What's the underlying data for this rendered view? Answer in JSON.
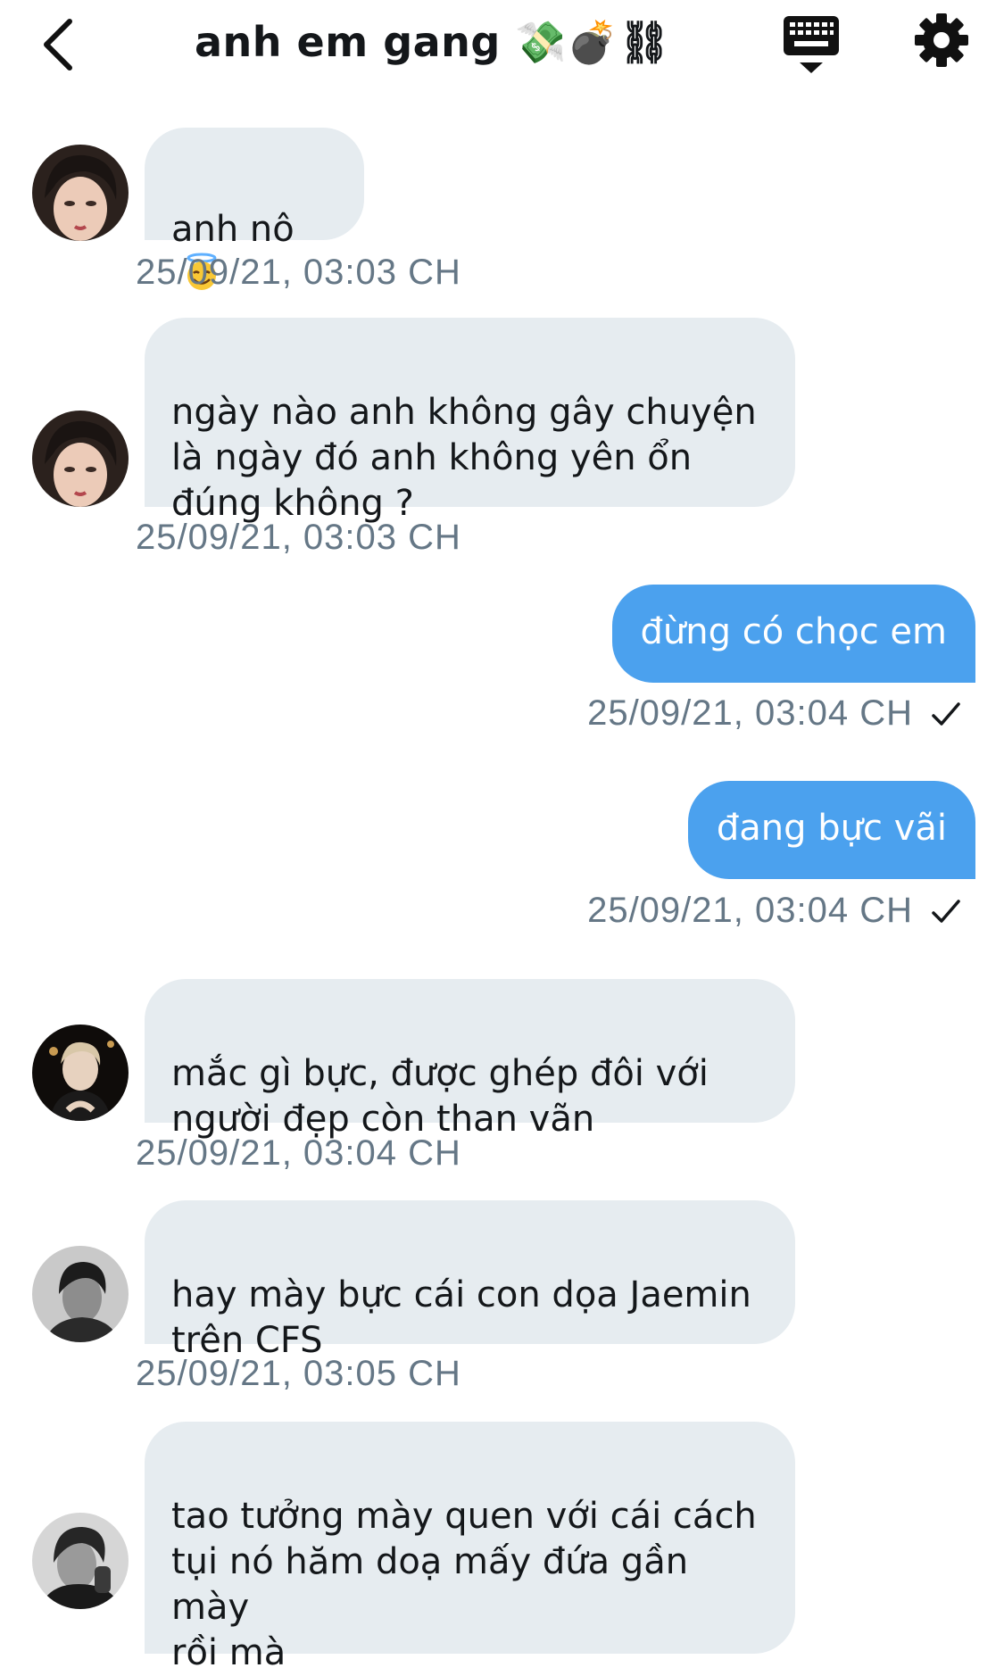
{
  "header": {
    "back_icon": "chevron-left-icon",
    "title": "anh em gang 💸💣⛓",
    "keyboard_icon": "keyboard-icon",
    "settings_icon": "gear-icon"
  },
  "messages": [
    {
      "direction": "in",
      "text": "anh nô",
      "emoji": "smiling-face-with-halo",
      "timestamp": "25/09/21, 03:03 CH"
    },
    {
      "direction": "in",
      "text": "ngày nào anh không gây chuyện\nlà ngày đó anh không yên ổn\nđúng không ?",
      "timestamp": "25/09/21, 03:03 CH"
    },
    {
      "direction": "out",
      "text": "đừng có chọc em",
      "timestamp": "25/09/21, 03:04 CH",
      "read": true
    },
    {
      "direction": "out",
      "text": "đang bực vãi",
      "timestamp": "25/09/21, 03:04 CH",
      "read": true
    },
    {
      "direction": "in",
      "text": "mắc gì bực, được ghép đôi với\nngười đẹp còn than vãn",
      "timestamp": "25/09/21, 03:04 CH"
    },
    {
      "direction": "in",
      "text": " hay mày bực cái con dọa Jaemin\ntrên CFS",
      "timestamp": "25/09/21, 03:05 CH"
    },
    {
      "direction": "in",
      "text": "tao tưởng mày quen với cái cách\ntụi nó hăm doạ mấy đứa gần mày\nrồi mà"
    }
  ],
  "colors": {
    "incoming_bubble": "#e6ecf0",
    "outgoing_bubble": "#4ba1ee",
    "timestamp": "#657786",
    "text": "#14171a"
  }
}
